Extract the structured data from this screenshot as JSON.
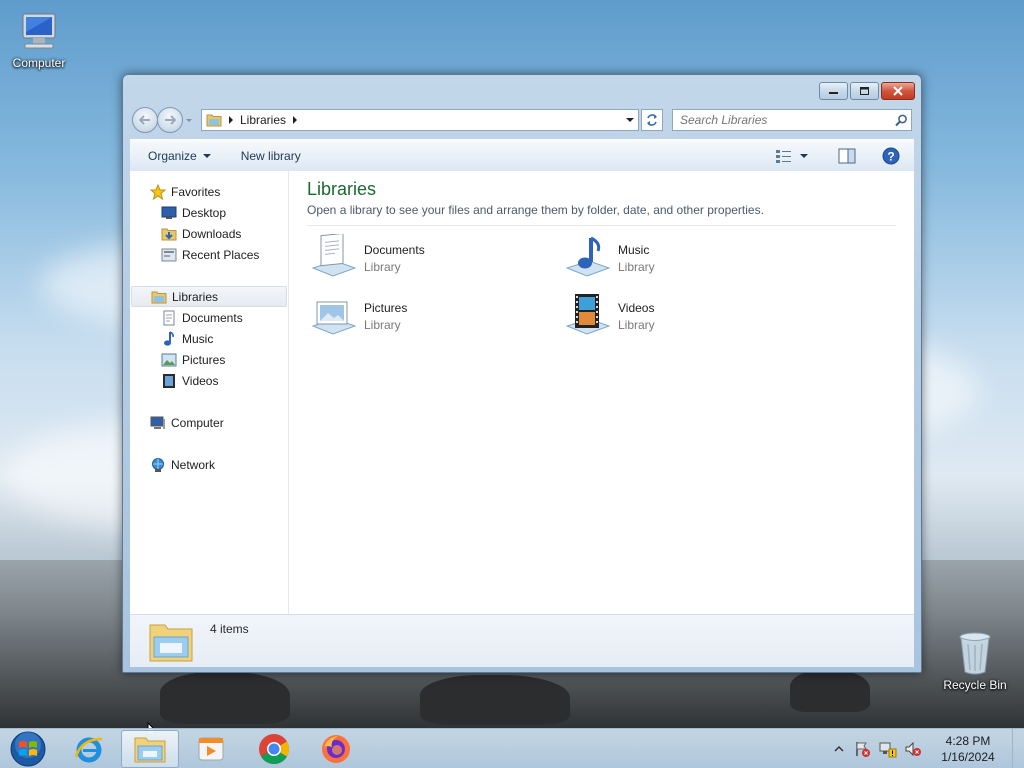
{
  "desktop": {
    "icons": [
      {
        "label": "Computer"
      },
      {
        "label": "Recycle Bin"
      }
    ]
  },
  "window": {
    "address": {
      "crumbs": [
        "Libraries"
      ]
    },
    "search": {
      "placeholder": "Search Libraries"
    },
    "toolbar": {
      "organize_label": "Organize",
      "new_library_label": "New library"
    },
    "sidebar": {
      "favorites": {
        "label": "Favorites",
        "items": [
          {
            "label": "Desktop",
            "icon": "desktop-icon"
          },
          {
            "label": "Downloads",
            "icon": "downloads-icon"
          },
          {
            "label": "Recent Places",
            "icon": "recent-places-icon"
          }
        ]
      },
      "libraries": {
        "label": "Libraries",
        "items": [
          {
            "label": "Documents",
            "icon": "documents-icon"
          },
          {
            "label": "Music",
            "icon": "music-icon"
          },
          {
            "label": "Pictures",
            "icon": "pictures-icon"
          },
          {
            "label": "Videos",
            "icon": "videos-icon"
          }
        ]
      },
      "computer": {
        "label": "Computer"
      },
      "network": {
        "label": "Network"
      }
    },
    "content": {
      "title": "Libraries",
      "subtitle": "Open a library to see your files and arrange them by folder, date, and other properties.",
      "libraries": [
        {
          "name": "Documents",
          "type": "Library",
          "icon": "documents-library-icon"
        },
        {
          "name": "Music",
          "type": "Library",
          "icon": "music-library-icon"
        },
        {
          "name": "Pictures",
          "type": "Library",
          "icon": "pictures-library-icon"
        },
        {
          "name": "Videos",
          "type": "Library",
          "icon": "videos-library-icon"
        }
      ]
    },
    "details": {
      "count": "4 items"
    }
  },
  "taskbar": {
    "pinned": [
      "start-orb-icon",
      "internet-explorer-icon",
      "windows-explorer-icon",
      "media-player-icon",
      "chrome-icon",
      "firefox-icon"
    ],
    "clock": {
      "time": "4:28 PM",
      "date": "1/16/2024"
    }
  },
  "colors": {
    "title_green": "#1a6b2e",
    "window_frame": "#b5cde4",
    "close_red": "#c23b22"
  }
}
